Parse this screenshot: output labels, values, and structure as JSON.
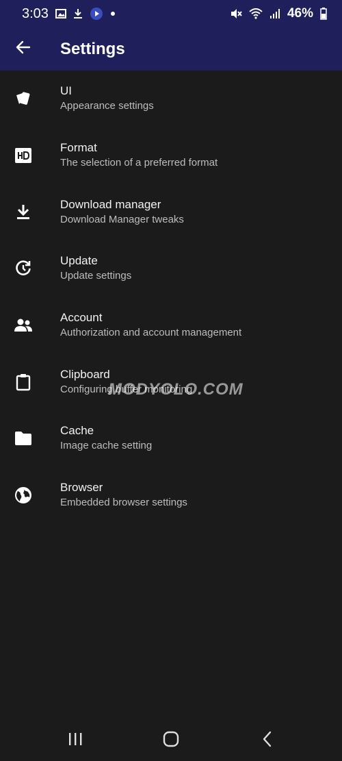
{
  "status_bar": {
    "time": "3:03",
    "battery": "46%",
    "icons": [
      "gallery-icon",
      "download-icon",
      "media-app-icon",
      "notification-dot-icon",
      "mute-icon",
      "wifi-icon",
      "signal-icon",
      "battery-icon"
    ]
  },
  "app_bar": {
    "title": "Settings",
    "back_icon": "back-arrow-icon"
  },
  "settings": [
    {
      "title": "UI",
      "subtitle": "Appearance settings",
      "icon": "ui-cards-icon"
    },
    {
      "title": "Format",
      "subtitle": "The selection of a preferred format",
      "icon": "hd-icon"
    },
    {
      "title": "Download manager",
      "subtitle": "Download Manager tweaks",
      "icon": "download-icon"
    },
    {
      "title": "Update",
      "subtitle": "Update settings",
      "icon": "update-icon"
    },
    {
      "title": "Account",
      "subtitle": "Authorization and account management",
      "icon": "account-icon"
    },
    {
      "title": "Clipboard",
      "subtitle": "Configuring buffer monitoring",
      "icon": "clipboard-icon"
    },
    {
      "title": "Cache",
      "subtitle": "Image cache setting",
      "icon": "folder-icon"
    },
    {
      "title": "Browser",
      "subtitle": "Embedded browser settings",
      "icon": "globe-icon"
    }
  ],
  "watermark": "MODYOLO.COM",
  "nav_bar": {
    "icons": [
      "recent-apps-icon",
      "home-icon",
      "back-icon"
    ]
  },
  "colors": {
    "header_bg": "#1f1f5c",
    "background": "#1b1b1b",
    "title_text": "#f2f2f2",
    "subtitle_text": "#bdbdbd"
  }
}
